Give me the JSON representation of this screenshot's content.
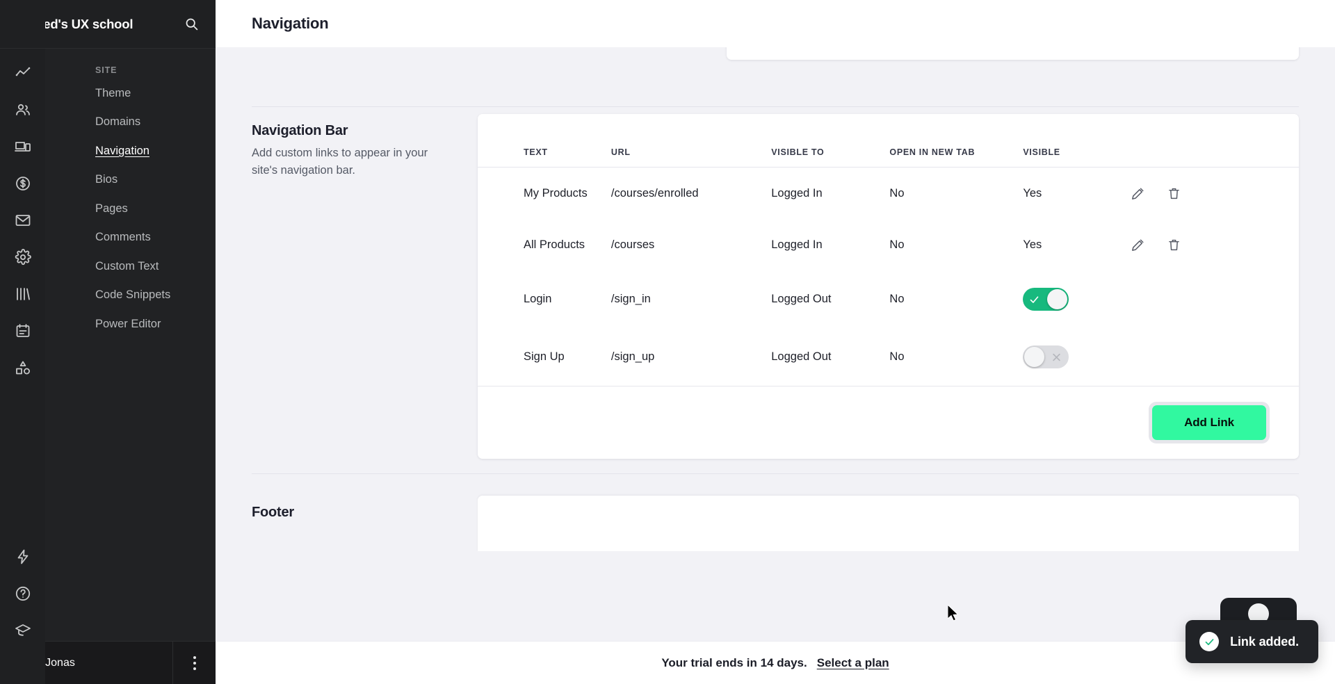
{
  "brand": {
    "title": "UI Feed's UX school",
    "search_icon": "search-icon"
  },
  "rail": {
    "icons": [
      {
        "name": "analytics-icon"
      },
      {
        "name": "people-icon"
      },
      {
        "name": "devices-icon"
      },
      {
        "name": "dollar-circle-icon"
      },
      {
        "name": "mail-icon"
      },
      {
        "name": "gear-icon"
      },
      {
        "name": "books-icon"
      },
      {
        "name": "calendar-icon"
      },
      {
        "name": "shapes-icon"
      }
    ],
    "bottom_icons": [
      {
        "name": "lightning-icon"
      },
      {
        "name": "help-circle-icon"
      },
      {
        "name": "graduation-cap-icon"
      }
    ]
  },
  "sidebar": {
    "group_label": "SITE",
    "items": [
      {
        "label": "Theme",
        "active": false
      },
      {
        "label": "Domains",
        "active": false
      },
      {
        "label": "Navigation",
        "active": true
      },
      {
        "label": "Bios",
        "active": false
      },
      {
        "label": "Pages",
        "active": false
      },
      {
        "label": "Comments",
        "active": false
      },
      {
        "label": "Custom Text",
        "active": false
      },
      {
        "label": "Code Snippets",
        "active": false
      },
      {
        "label": "Power Editor",
        "active": false
      }
    ]
  },
  "user": {
    "name": "Sarah Jonas",
    "more_icon": "more-vertical-icon"
  },
  "header": {
    "title": "Navigation"
  },
  "nav_section": {
    "title": "Navigation Bar",
    "description": "Add custom links to appear in your site's navigation bar.",
    "columns": [
      "TEXT",
      "URL",
      "VISIBLE TO",
      "OPEN IN NEW TAB",
      "VISIBLE"
    ],
    "rows": [
      {
        "text": "My Products",
        "url": "/courses/enrolled",
        "visible_to": "Logged In",
        "new_tab": "No",
        "visible": "Yes",
        "control": "text",
        "actions": [
          "edit-icon",
          "delete-icon"
        ]
      },
      {
        "text": "All Products",
        "url": "/courses",
        "visible_to": "Logged In",
        "new_tab": "No",
        "visible": "Yes",
        "control": "text",
        "actions": [
          "edit-icon",
          "delete-icon"
        ]
      },
      {
        "text": "Login",
        "url": "/sign_in",
        "visible_to": "Logged Out",
        "new_tab": "No",
        "visible": "",
        "control": "toggle-on",
        "actions": []
      },
      {
        "text": "Sign Up",
        "url": "/sign_up",
        "visible_to": "Logged Out",
        "new_tab": "No",
        "visible": "",
        "control": "toggle-off",
        "actions": []
      }
    ],
    "add_button": "Add Link"
  },
  "footer_section": {
    "title": "Footer"
  },
  "trial": {
    "message": "Your trial ends in 14 days.",
    "link": "Select a plan"
  },
  "toast": {
    "message": "Link added.",
    "icon": "check-circle-icon"
  },
  "colors": {
    "rail_bg": "#1f2022",
    "sidebar_bg": "#212224",
    "main_bg": "#f2f2f6",
    "accent_green": "#31f8a0",
    "toggle_on": "#17b97e",
    "toggle_off": "#dcdde1"
  }
}
